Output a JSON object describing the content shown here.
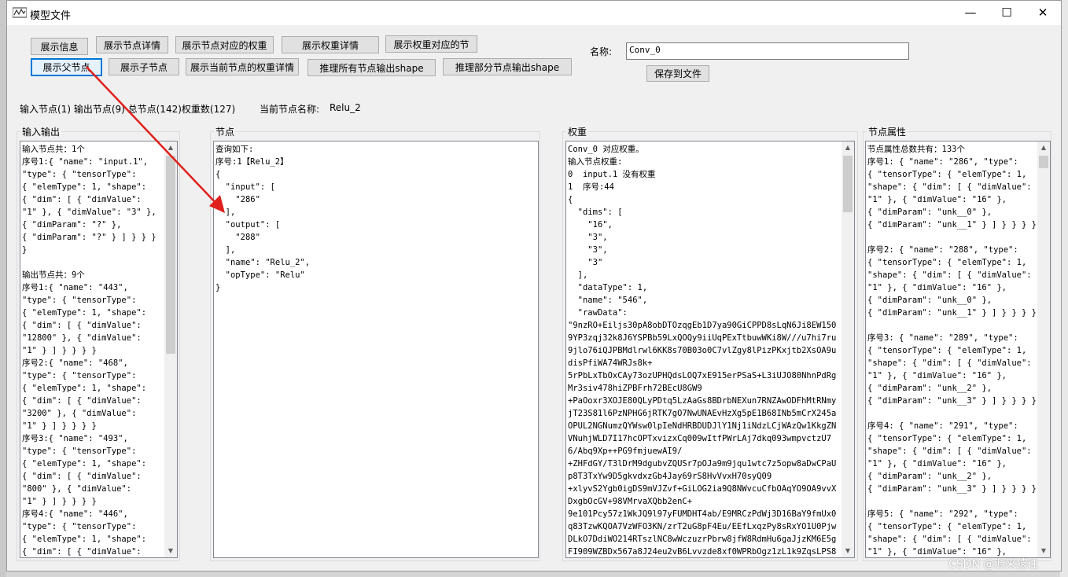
{
  "window": {
    "title": "模型文件",
    "minimize": "—",
    "maximize": "☐",
    "close": "✕"
  },
  "toolbar": {
    "row1": [
      "展示信息",
      "展示节点详情",
      "展示节点对应的权重",
      "展示权重详情",
      "展示权重对应的节"
    ],
    "row2": [
      "展示父节点",
      "展示子节点",
      "展示当前节点的权重详情",
      "推理所有节点输出shape",
      "推理部分节点输出shape"
    ]
  },
  "name_label": "名称:",
  "name_value": "Conv_0",
  "save_button": "保存到文件",
  "status": {
    "summary": "输入节点(1) 输出节点(9) 总节点(142)权重数(127)",
    "current_label": "当前节点名称:",
    "current_value": "Relu_2"
  },
  "panels": {
    "io": {
      "title": "输入输出",
      "text": "输入节点共：1个\n序号1:{ \"name\": \"input.1\",\n\"type\": { \"tensorType\":\n{ \"elemType\": 1, \"shape\":\n{ \"dim\": [ { \"dimValue\":\n\"1\" }, { \"dimValue\": \"3\" },\n{ \"dimParam\": \"?\" },\n{ \"dimParam\": \"?\" } ] } } } }\n\n输出节点共：9个\n序号1:{ \"name\": \"443\",\n\"type\": { \"tensorType\":\n{ \"elemType\": 1, \"shape\":\n{ \"dim\": [ { \"dimValue\":\n\"12800\" }, { \"dimValue\":\n\"1\" } ] } } } }\n序号2:{ \"name\": \"468\",\n\"type\": { \"tensorType\":\n{ \"elemType\": 1, \"shape\":\n{ \"dim\": [ { \"dimValue\":\n\"3200\" }, { \"dimValue\":\n\"1\" } ] } } } }\n序号3:{ \"name\": \"493\",\n\"type\": { \"tensorType\":\n{ \"elemType\": 1, \"shape\":\n{ \"dim\": [ { \"dimValue\":\n\"800\" }, { \"dimValue\":\n\"1\" } ] } } } }\n序号4:{ \"name\": \"446\",\n\"type\": { \"tensorType\":\n{ \"elemType\": 1, \"shape\":\n{ \"dim\": [ { \"dimValue\":\n\"12800\" }, { \"dimValue\":"
    },
    "node": {
      "title": "节点",
      "text": "查询如下:\n序号:1【Relu_2】\n{\n  \"input\": [\n    \"286\"\n  ],\n  \"output\": [\n    \"288\"\n  ],\n  \"name\": \"Relu_2\",\n  \"opType\": \"Relu\"\n}"
    },
    "weights": {
      "title": "权重",
      "text": "Conv_0 对应权重。\n输入节点权重:\n0  input.1 没有权重\n1  序号:44\n{\n  \"dims\": [\n    \"16\",\n    \"3\",\n    \"3\",\n    \"3\"\n  ],\n  \"dataType\": 1,\n  \"name\": \"546\",\n  \"rawData\":\n\"9nzRO+Eiljs30pA8obDTOzqgEb1D7ya90GiCPPD8sLqN6Ji8EW1509YP3zqj32k8J6YSPBb59LxQOQy9iiUqPExTtbuwWKi8W///u7hi7ru9jlo76iQJPBMdlrwl6KK8s70B03o0C7vlZgy8lPizPKxjtb2XsOA9udisPfiWA74WRJs8k+\n5rPbLxTbOxCAy73ozUPHQdsLOQ7xE915erPSaS+L3iUJO80NhnPdRgMr3siv478hiZPBFrh72BEcU8GW9\n+PaOoxr3XOJE80QLyPDtq5LzAaGs8BDrbNEXun7RNZAwODFhMtRNmyjT23S81l6PzNPHG6jRTK7gO7NwUNAEvHzXg5pE1B68INb5mCrX245aOPUL2NGNumzQYWsw0lpIeNdHRBDUDJlY1Nj1iNdzLCjWAzQw1KkgZNVNuhjWLD7I17hcOPTxvizxCq009wItfPWrLAj7dkq093wmpvctzU76/Abq9Xp++PG9fmjuewAI9/\n+ZHFdGY/T3lDrM9dgubvZQUSr7pOJa9m9jqu1wtc7z5opw8aDwCPaUp8T3TxYw9D5gkvdxzGb4Jay69rS8HvVvxH70syQ09\n+xlyvS2Ygb0igDS9mVJZvf+GiLOG2ia9Q8NWvcuCfbOAqYO9OA9vvXDxgbOcGV+98VMrvaXQbb2enC+\n9e101Pcy57z1WkJQ9l97yFUMDHT4ab/E9MRCzPdWj3D16BaY9fmUx0q83TzwKQOA7VzWFO3KN/zrT2uG8pF4Eu/EEfLxqzPy8sRxYO1U0PjwDLkO7DdiWO214RTszlNC8wWczuzrPbrw8jfW8RdmHu6gaJjzKM6E5gFI909WZBDx567a8J24eu2vB6Lvvzde8xf0WPRbOgz1zL1k9ZqsLPS8Iyb1cE5A9Dez"
    },
    "props": {
      "title": "节点属性",
      "text": "节点属性总数共有：133个\n序号1: { \"name\": \"286\", \"type\":\n{ \"tensorType\": { \"elemType\": 1,\n\"shape\": { \"dim\": [ { \"dimValue\":\n\"1\" }, { \"dimValue\": \"16\" },\n{ \"dimParam\": \"unk__0\" },\n{ \"dimParam\": \"unk__1\" } ] } } } }\n\n序号2: { \"name\": \"288\", \"type\":\n{ \"tensorType\": { \"elemType\": 1,\n\"shape\": { \"dim\": [ { \"dimValue\":\n\"1\" }, { \"dimValue\": \"16\" },\n{ \"dimParam\": \"unk__0\" },\n{ \"dimParam\": \"unk__1\" } ] } } } }\n\n序号3: { \"name\": \"289\", \"type\":\n{ \"tensorType\": { \"elemType\": 1,\n\"shape\": { \"dim\": [ { \"dimValue\":\n\"1\" }, { \"dimValue\": \"16\" },\n{ \"dimParam\": \"unk__2\" },\n{ \"dimParam\": \"unk__3\" } ] } } } }\n\n序号4: { \"name\": \"291\", \"type\":\n{ \"tensorType\": { \"elemType\": 1,\n\"shape\": { \"dim\": [ { \"dimValue\":\n\"1\" }, { \"dimValue\": \"16\" },\n{ \"dimParam\": \"unk__2\" },\n{ \"dimParam\": \"unk__3\" } ] } } } }\n\n序号5: { \"name\": \"292\", \"type\":\n{ \"tensorType\": { \"elemType\": 1,\n\"shape\": { \"dim\": [ { \"dimValue\":\n\"1\" }, { \"dimValue\": \"16\" },"
    }
  },
  "watermark": "CSDN @源来猿往"
}
